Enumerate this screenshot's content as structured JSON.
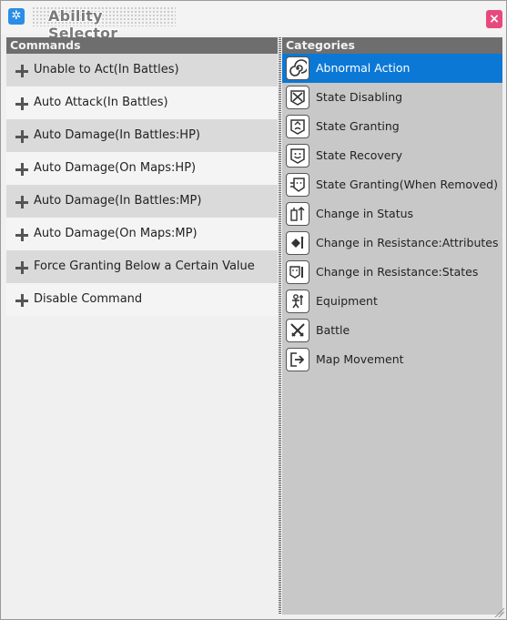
{
  "window": {
    "title": "Ability Selector",
    "close_glyph": "×",
    "app_icon": "gear-icon"
  },
  "commands": {
    "header": "Commands",
    "items": [
      {
        "label": "Unable to Act(In Battles)",
        "icon": "plus-icon"
      },
      {
        "label": "Auto Attack(In Battles)",
        "icon": "plus-icon"
      },
      {
        "label": "Auto Damage(In Battles:HP)",
        "icon": "plus-icon"
      },
      {
        "label": "Auto Damage(On Maps:HP)",
        "icon": "plus-icon"
      },
      {
        "label": "Auto Damage(In Battles:MP)",
        "icon": "plus-icon"
      },
      {
        "label": "Auto Damage(On Maps:MP)",
        "icon": "plus-icon"
      },
      {
        "label": "Force Granting Below a Certain Value",
        "icon": "plus-icon"
      },
      {
        "label": "Disable Command",
        "icon": "plus-icon"
      }
    ]
  },
  "categories": {
    "header": "Categories",
    "selected_index": 0,
    "items": [
      {
        "label": "Abnormal Action",
        "icon": "spiral-icon"
      },
      {
        "label": "State Disabling",
        "icon": "cross-out-icon"
      },
      {
        "label": "State Granting",
        "icon": "grant-state-icon"
      },
      {
        "label": "State Recovery",
        "icon": "recovery-icon"
      },
      {
        "label": "State Granting(When Removed)",
        "icon": "grant-on-remove-icon"
      },
      {
        "label": "Change in Status",
        "icon": "status-change-icon"
      },
      {
        "label": "Change in Resistance:Attributes",
        "icon": "attribute-resistance-icon"
      },
      {
        "label": "Change in Resistance:States",
        "icon": "state-resistance-icon"
      },
      {
        "label": "Equipment",
        "icon": "equipment-icon"
      },
      {
        "label": "Battle",
        "icon": "crossed-swords-icon"
      },
      {
        "label": "Map Movement",
        "icon": "exit-door-icon"
      }
    ]
  },
  "colors": {
    "selection": "#0b78d6",
    "header_bg": "#6e6e6e",
    "close_button": "#e8497c"
  }
}
